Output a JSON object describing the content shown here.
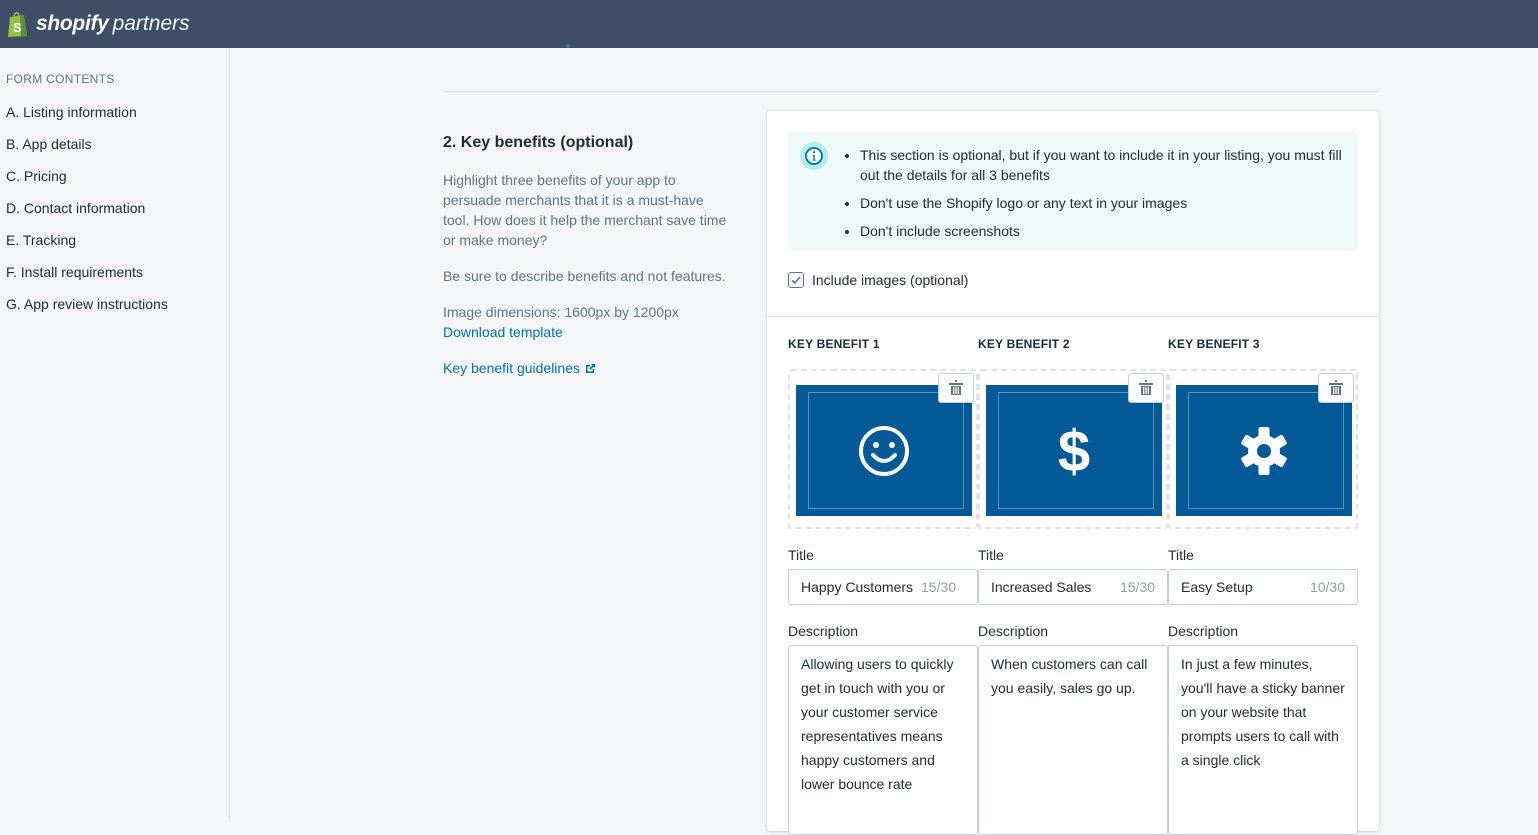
{
  "header": {
    "logo_brand": "shopify",
    "logo_product": "partners"
  },
  "sidebar": {
    "heading": "FORM CONTENTS",
    "items": [
      {
        "label": "A. Listing information"
      },
      {
        "label": "B. App details"
      },
      {
        "label": "C. Pricing"
      },
      {
        "label": "D. Contact information"
      },
      {
        "label": "E. Tracking"
      },
      {
        "label": "F. Install requirements"
      },
      {
        "label": "G. App review instructions"
      }
    ]
  },
  "section": {
    "title": "2. Key benefits (optional)",
    "paragraph1": "Highlight three benefits of your app to persuade merchants that it is a must-have tool. How does it help the merchant save time or make money?",
    "paragraph2": "Be sure to describe benefits and not features.",
    "dimensions": "Image dimensions: 1600px by 1200px",
    "download_link": "Download template",
    "guidelines_link": "Key benefit guidelines"
  },
  "banner": {
    "icon": "info-icon",
    "items": [
      "This section is optional, but if you want to include it in your listing, you must fill out the details for all 3 benefits",
      "Don't use the Shopify logo or any text in your images",
      "Don't include screenshots"
    ]
  },
  "include_images": {
    "label": "Include images (optional)",
    "checked": true
  },
  "benefits": [
    {
      "heading": "KEY BENEFIT 1",
      "image_icon": "smiley-icon",
      "title_label": "Title",
      "title_value": "Happy Customers",
      "title_count": "15/30",
      "description_label": "Description",
      "description_value": "Allowing users to quickly get in touch with you or your customer service representatives means happy customers and lower bounce rate"
    },
    {
      "heading": "KEY BENEFIT 2",
      "image_icon": "dollar-icon",
      "title_label": "Title",
      "title_value": "Increased Sales",
      "title_count": "15/30",
      "description_label": "Description",
      "description_value": "When customers can call you easily, sales go up."
    },
    {
      "heading": "KEY BENEFIT 3",
      "image_icon": "gear-icon",
      "title_label": "Title",
      "title_value": "Easy Setup",
      "title_count": "10/30",
      "description_label": "Description",
      "description_value": "In just a few minutes, you'll have a sticky banner on your website that prompts users to call with a single click"
    }
  ],
  "colors": {
    "topbar": "#3d4e66",
    "image_bg": "#035a96",
    "link": "#006fbb",
    "banner_bg": "#eef9f9"
  }
}
